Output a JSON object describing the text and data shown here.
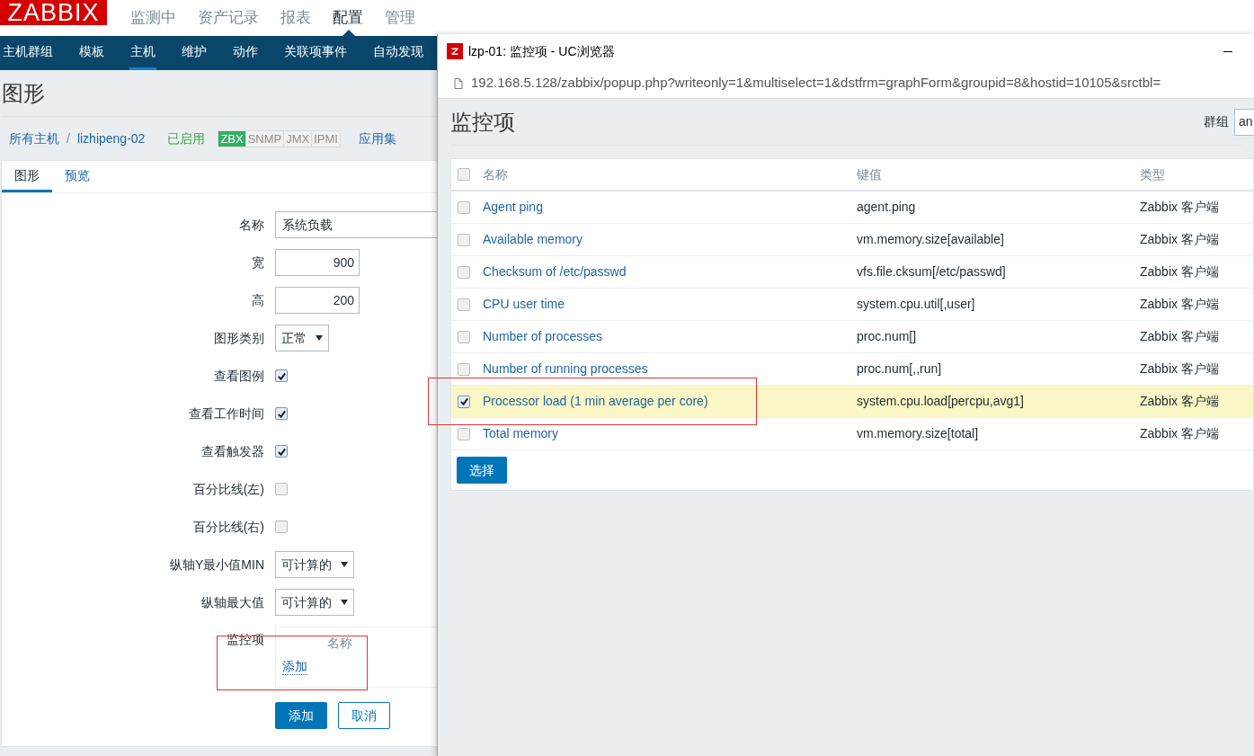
{
  "logo": "ZABBIX",
  "main_menu": [
    {
      "label": "监测中",
      "selected": false
    },
    {
      "label": "资产记录",
      "selected": false
    },
    {
      "label": "报表",
      "selected": false
    },
    {
      "label": "配置",
      "selected": true
    },
    {
      "label": "管理",
      "selected": false
    }
  ],
  "sub_menu": [
    {
      "label": "主机群组",
      "selected": false
    },
    {
      "label": "模板",
      "selected": false
    },
    {
      "label": "主机",
      "selected": true
    },
    {
      "label": "维护",
      "selected": false
    },
    {
      "label": "动作",
      "selected": false
    },
    {
      "label": "关联项事件",
      "selected": false
    },
    {
      "label": "自动发现",
      "selected": false
    }
  ],
  "page_title": "图形",
  "breadcrumb": {
    "all_hosts": "所有主机",
    "separator": "/",
    "host": "lizhipeng-02",
    "status": "已启用",
    "availability": [
      {
        "label": "ZBX",
        "on": true
      },
      {
        "label": "SNMP",
        "on": false
      },
      {
        "label": "JMX",
        "on": false
      },
      {
        "label": "IPMI",
        "on": false
      }
    ],
    "applications": "应用集"
  },
  "tabs": [
    {
      "label": "图形",
      "selected": true
    },
    {
      "label": "预览",
      "selected": false
    }
  ],
  "form": {
    "rows": [
      {
        "kind": "text",
        "label": "名称",
        "value": "系统负载"
      },
      {
        "kind": "number",
        "label": "宽",
        "value": "900"
      },
      {
        "kind": "number",
        "label": "高",
        "value": "200"
      },
      {
        "kind": "select",
        "label": "图形类别",
        "value": "正常"
      },
      {
        "kind": "checkbox",
        "label": "查看图例",
        "checked": true
      },
      {
        "kind": "checkbox",
        "label": "查看工作时间",
        "checked": true
      },
      {
        "kind": "checkbox",
        "label": "查看触发器",
        "checked": true
      },
      {
        "kind": "checkbox",
        "label": "百分比线(左)",
        "checked": false
      },
      {
        "kind": "checkbox",
        "label": "百分比线(右)",
        "checked": false
      },
      {
        "kind": "select",
        "label": "纵轴Y最小值MIN",
        "value": "可计算的"
      },
      {
        "kind": "select",
        "label": "纵轴最大值",
        "value": "可计算的"
      },
      {
        "kind": "items",
        "label": "监控项",
        "column": "名称",
        "link": "添加"
      }
    ],
    "buttons": [
      {
        "label": "添加",
        "kind": "primary"
      },
      {
        "label": "取消",
        "kind": "secondary"
      }
    ]
  },
  "popup": {
    "title": "lzp-01: 监控项 - UC浏览器",
    "url": "192.168.5.128/zabbix/popup.php?writeonly=1&multiselect=1&dstfrm=graphForm&groupid=8&hostid=10105&srctbl=",
    "heading": "监控项",
    "group_label": "群组",
    "group_value": "an",
    "columns": [
      "名称",
      "键值",
      "类型"
    ],
    "select_all_checked": false,
    "rows": [
      {
        "name": "Agent ping",
        "key": "agent.ping",
        "type": "Zabbix 客户端",
        "checked": false
      },
      {
        "name": "Available memory",
        "key": "vm.memory.size[available]",
        "type": "Zabbix 客户端",
        "checked": false
      },
      {
        "name": "Checksum of /etc/passwd",
        "key": "vfs.file.cksum[/etc/passwd]",
        "type": "Zabbix 客户端",
        "checked": false
      },
      {
        "name": "CPU user time",
        "key": "system.cpu.util[,user]",
        "type": "Zabbix 客户端",
        "checked": false
      },
      {
        "name": "Number of processes",
        "key": "proc.num[]",
        "type": "Zabbix 客户端",
        "checked": false
      },
      {
        "name": "Number of running processes",
        "key": "proc.num[,,run]",
        "type": "Zabbix 客户端",
        "checked": false
      },
      {
        "name": "Processor load (1 min average per core)",
        "key": "system.cpu.load[percpu,avg1]",
        "type": "Zabbix 客户端",
        "checked": true
      },
      {
        "name": "Total memory",
        "key": "vm.memory.size[total]",
        "type": "Zabbix 客户端",
        "checked": false
      }
    ],
    "button": "选择"
  }
}
